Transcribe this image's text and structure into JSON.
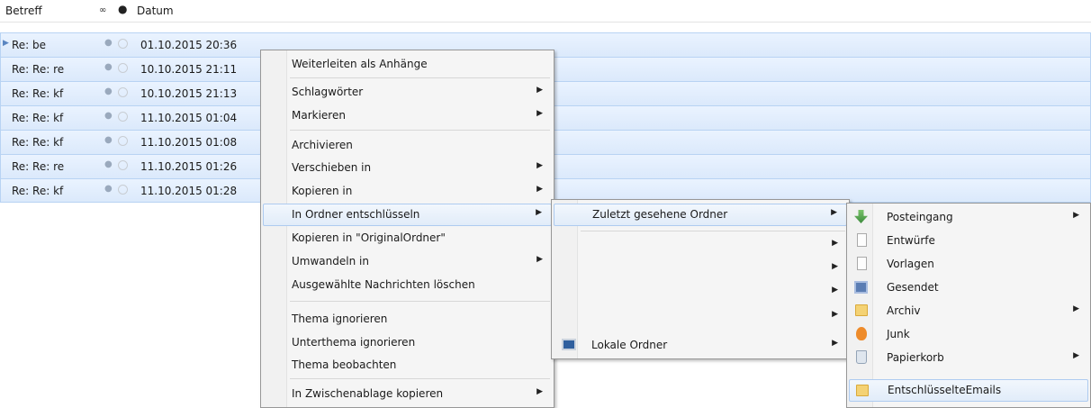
{
  "header": {
    "betreff": "Betreff",
    "thread_icon": "∞",
    "read_icon": "●",
    "datum": "Datum"
  },
  "messages": [
    {
      "subject": "Re: be",
      "date": "01.10.2015 20:36"
    },
    {
      "subject": "Re: Re: re",
      "date": "10.10.2015 21:11"
    },
    {
      "subject": "Re: Re: kf",
      "date": "10.10.2015 21:13"
    },
    {
      "subject": "Re: Re: kf",
      "date": "11.10.2015 01:04"
    },
    {
      "subject": "Re: Re: kf",
      "date": "11.10.2015 01:08"
    },
    {
      "subject": "Re: Re: re",
      "date": "11.10.2015 01:26"
    },
    {
      "subject": "Re: Re: kf",
      "date": "11.10.2015 01:28"
    }
  ],
  "context_menu": {
    "forward_attachments": "Weiterleiten als Anhänge",
    "tags": "Schlagwörter",
    "mark": "Markieren",
    "archive": "Archivieren",
    "move_to": "Verschieben in",
    "copy_to": "Kopieren in",
    "decrypt_to_folder": "In Ordner entschlüsseln",
    "copy_to_original": "Kopieren in \"OriginalOrdner\"",
    "convert_to": "Umwandeln in",
    "delete_selected": "Ausgewählte Nachrichten löschen",
    "ignore_thread": "Thema ignorieren",
    "ignore_subthread": "Unterthema ignorieren",
    "watch_thread": "Thema beobachten",
    "copy_clipboard": "In Zwischenablage kopieren",
    "submenu_arrow": "▶"
  },
  "submenu": {
    "recent_folders": "Zuletzt gesehene Ordner",
    "local_folders": "Lokale Ordner"
  },
  "folders": {
    "inbox": "Posteingang",
    "drafts": "Entwürfe",
    "templates": "Vorlagen",
    "sent": "Gesendet",
    "archive": "Archiv",
    "junk": "Junk",
    "trash": "Papierkorb",
    "decrypted": "EntschlüsselteEmails"
  },
  "colors": {
    "selection": "#dbe9fb",
    "highlight_border": "#aecbf0",
    "menu_bg": "#f5f5f5"
  }
}
